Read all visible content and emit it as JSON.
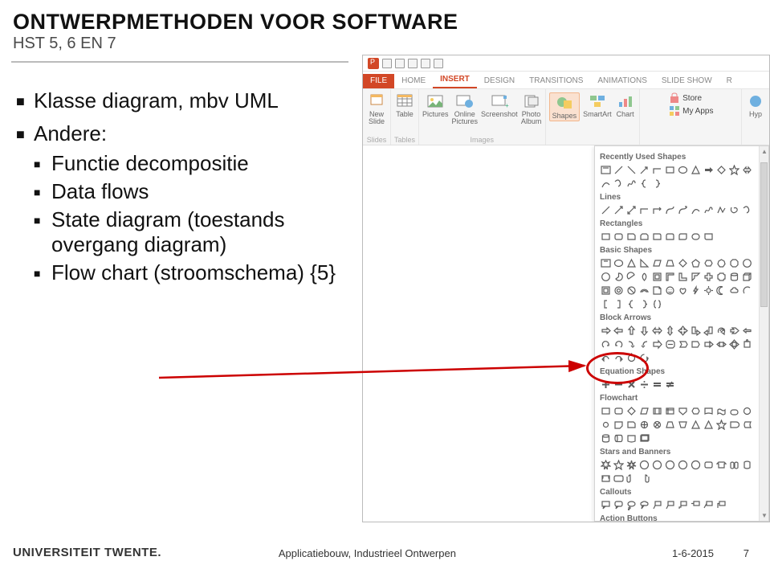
{
  "title": "ONTWERPMETHODEN VOOR SOFTWARE",
  "subtitle": "HST 5, 6 EN 7",
  "bullets": {
    "b1": "Klasse diagram, mbv UML",
    "b2": "Andere:",
    "s1": "Functie decompositie",
    "s2": "Data flows",
    "s3": "State diagram (toestands overgang diagram)",
    "s4": "Flow chart (stroomschema) {5}"
  },
  "powerpoint": {
    "tabs": {
      "file": "FILE",
      "home": "HOME",
      "insert": "INSERT",
      "design": "DESIGN",
      "transitions": "TRANSITIONS",
      "animations": "ANIMATIONS",
      "slideshow": "SLIDE SHOW",
      "r": "R"
    },
    "ribbon": {
      "new_slide": "New\nSlide",
      "slides_group": "Slides",
      "table": "Table",
      "tables_group": "Tables",
      "pictures": "Pictures",
      "online_pictures": "Online\nPictures",
      "screenshot": "Screenshot",
      "photo_album": "Photo\nAlbum",
      "images_group": "Images",
      "shapes": "Shapes",
      "smartart": "SmartArt",
      "chart": "Chart",
      "store": "Store",
      "myapps": "My Apps",
      "hyp": "Hyp"
    },
    "shapes_panel": {
      "recent": "Recently Used Shapes",
      "lines": "Lines",
      "rectangles": "Rectangles",
      "basic": "Basic Shapes",
      "block": "Block Arrows",
      "equation": "Equation Shapes",
      "flowchart": "Flowchart",
      "stars": "Stars and Banners",
      "callouts": "Callouts",
      "action": "Action Buttons"
    }
  },
  "footer": {
    "university": "UNIVERSITEIT TWENTE.",
    "center": "Applicatiebouw, Industrieel Ontwerpen",
    "date": "1-6-2015",
    "page": "7"
  }
}
